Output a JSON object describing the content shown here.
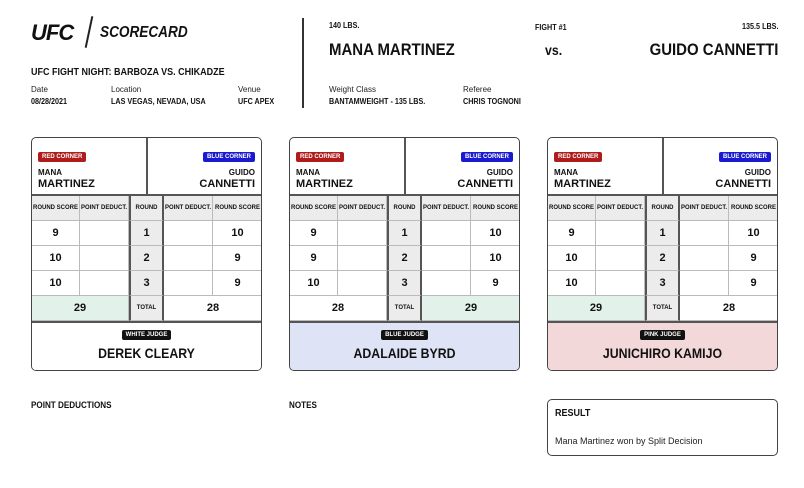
{
  "header": {
    "logo": "UFC",
    "title": "SCORECARD",
    "event": "UFC FIGHT NIGHT: BARBOZA VS. CHIKADZE",
    "date_label": "Date",
    "date": "08/28/2021",
    "location_label": "Location",
    "location": "LAS VEGAS, NEVADA, USA",
    "venue_label": "Venue",
    "venue": "UFC APEX"
  },
  "fight": {
    "red_weight": "140 LBS.",
    "red_name": "MANA MARTINEZ",
    "number": "FIGHT #1",
    "vs": "vs.",
    "blue_weight": "135.5 LBS.",
    "blue_name": "GUIDO CANNETTI",
    "weight_class_label": "Weight Class",
    "weight_class": "BANTAMWEIGHT - 135 LBS.",
    "referee_label": "Referee",
    "referee": "CHRIS TOGNONI"
  },
  "labels": {
    "red_corner": "RED CORNER",
    "blue_corner": "BLUE CORNER",
    "round_score": "ROUND SCORE",
    "point_deduct": "POINT DEDUCT.",
    "round": "ROUND",
    "total": "TOTAL"
  },
  "colors": {
    "red": "#b01c1c",
    "blue": "#1a1ad0",
    "winner_total": "#e2f2ea"
  },
  "cards": [
    {
      "red_first": "MANA",
      "red_last": "MARTINEZ",
      "blue_first": "GUIDO",
      "blue_last": "CANNETTI",
      "rounds": [
        {
          "round": "1",
          "red": "9",
          "blue": "10"
        },
        {
          "round": "2",
          "red": "10",
          "blue": "9"
        },
        {
          "round": "3",
          "red": "10",
          "blue": "9"
        }
      ],
      "red_total": "29",
      "blue_total": "28",
      "winner": "red",
      "judge_label": "WHITE JUDGE",
      "judge": "DEREK CLEARY",
      "bg": "#ffffff"
    },
    {
      "red_first": "MANA",
      "red_last": "MARTINEZ",
      "blue_first": "GUIDO",
      "blue_last": "CANNETTI",
      "rounds": [
        {
          "round": "1",
          "red": "9",
          "blue": "10"
        },
        {
          "round": "2",
          "red": "9",
          "blue": "10"
        },
        {
          "round": "3",
          "red": "10",
          "blue": "9"
        }
      ],
      "red_total": "28",
      "blue_total": "29",
      "winner": "blue",
      "judge_label": "BLUE JUDGE",
      "judge": "ADALAIDE BYRD",
      "bg": "#dfe3f6"
    },
    {
      "red_first": "MANA",
      "red_last": "MARTINEZ",
      "blue_first": "GUIDO",
      "blue_last": "CANNETTI",
      "rounds": [
        {
          "round": "1",
          "red": "9",
          "blue": "10"
        },
        {
          "round": "2",
          "red": "10",
          "blue": "9"
        },
        {
          "round": "3",
          "red": "10",
          "blue": "9"
        }
      ],
      "red_total": "29",
      "blue_total": "28",
      "winner": "red",
      "judge_label": "PINK JUDGE",
      "judge": "JUNICHIRO KAMIJO",
      "bg": "#f2d8d9"
    }
  ],
  "footer": {
    "point_deductions": "POINT DEDUCTIONS",
    "notes": "NOTES",
    "result_label": "RESULT",
    "result": "Mana Martinez won by Split Decision"
  }
}
